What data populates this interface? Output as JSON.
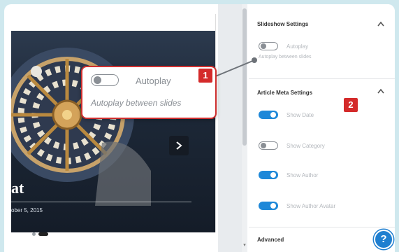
{
  "preview": {
    "slide_title_partial": "at",
    "slide_date_partial": "ober 5, 2015"
  },
  "callout": {
    "toggle_label": "Autoplay",
    "toggle_desc": "Autoplay between slides",
    "badge": "1"
  },
  "sidebar": {
    "slideshow": {
      "title": "Slideshow Settings",
      "autoplay_label": "Autoplay",
      "autoplay_desc": "Autoplay between slides",
      "autoplay_on": false
    },
    "article_meta": {
      "title": "Article Meta Settings",
      "badge": "2",
      "items": [
        {
          "label": "Show Date",
          "on": true
        },
        {
          "label": "Show Category",
          "on": false
        },
        {
          "label": "Show Author",
          "on": true
        },
        {
          "label": "Show Author Avatar",
          "on": true
        }
      ]
    },
    "advanced": {
      "title": "Advanced"
    },
    "help_glyph": "?"
  },
  "colors": {
    "accent_blue": "#1e88d8",
    "callout_red": "#cf2f2f",
    "background": "#cfe8ee"
  },
  "icons": [
    "next-arrow-icon",
    "chevron-up-icon",
    "help-icon",
    "toggle-switch-icon"
  ]
}
